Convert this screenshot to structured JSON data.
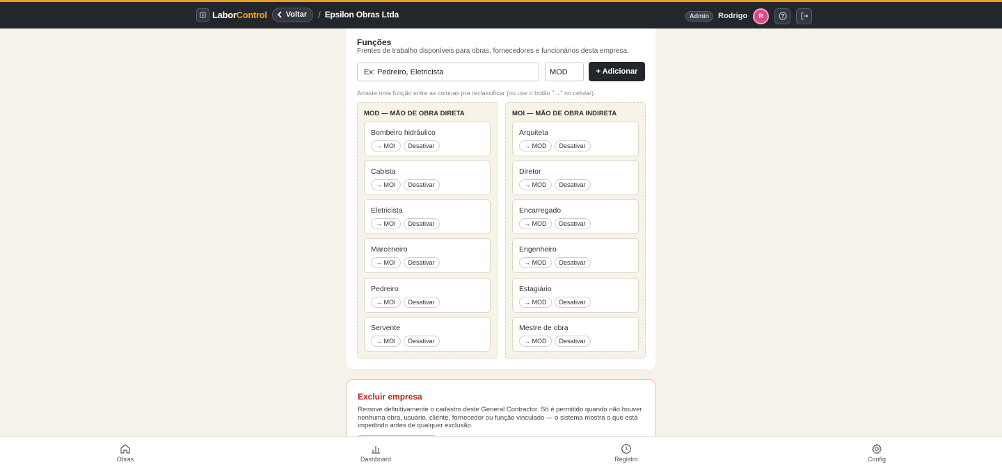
{
  "header": {
    "logo_left": "Labor",
    "logo_right": "Control",
    "back_label": "Voltar",
    "separator": "/",
    "company_name": "Epsilon Obras Ltda",
    "role_badge": "Admin",
    "user_name": "Rodrigo",
    "avatar_initial": "R"
  },
  "funcoes": {
    "title": "Funções",
    "description": "Frentes de trabalho disponíveis para obras, fornecedores e funcionários desta empresa.",
    "input_placeholder": "Ex: Pedreiro, Eletricista",
    "type_selected": "MOD",
    "add_label": "+ Adicionar",
    "hint": "Arraste uma função entre as colunas pra reclassificar (ou use o botão \"→\" no celular).",
    "mod_column": {
      "title": "MOD — MÃO DE OBRA DIRETA",
      "move_label": "→ MOI",
      "deactivate_label": "Desativar",
      "items": [
        "Bombeiro hidráulico",
        "Cabista",
        "Eletricista",
        "Marceneiro",
        "Pedreiro",
        "Servente"
      ]
    },
    "moi_column": {
      "title": "MOI — MÃO DE OBRA INDIRETA",
      "move_label": "→ MOD",
      "deactivate_label": "Desativar",
      "items": [
        "Arquiteta",
        "Diretor",
        "Encarregado",
        "Engenheiro",
        "Estagiário",
        "Mestre de obra"
      ]
    }
  },
  "danger_zone": {
    "title": "Excluir empresa",
    "text": "Remove definitivamente o cadastro deste General Contractor. Só é permitido quando não houver nenhuma obra, usuário, cliente, fornecedor ou função vinculado — o sistema mostra o que está impedindo antes de qualquer exclusão."
  },
  "bottom_nav": [
    {
      "label": "Obras",
      "icon": "home-icon"
    },
    {
      "label": "Dashboard",
      "icon": "bar-chart-icon"
    },
    {
      "label": "Registro",
      "icon": "clock-icon"
    },
    {
      "label": "Config",
      "icon": "gear-icon"
    }
  ],
  "colors": {
    "accent": "#e6a020",
    "topbar": "#23262b",
    "avatar": "#e0468a",
    "danger": "#b3261e",
    "background": "#f5f2ea"
  }
}
